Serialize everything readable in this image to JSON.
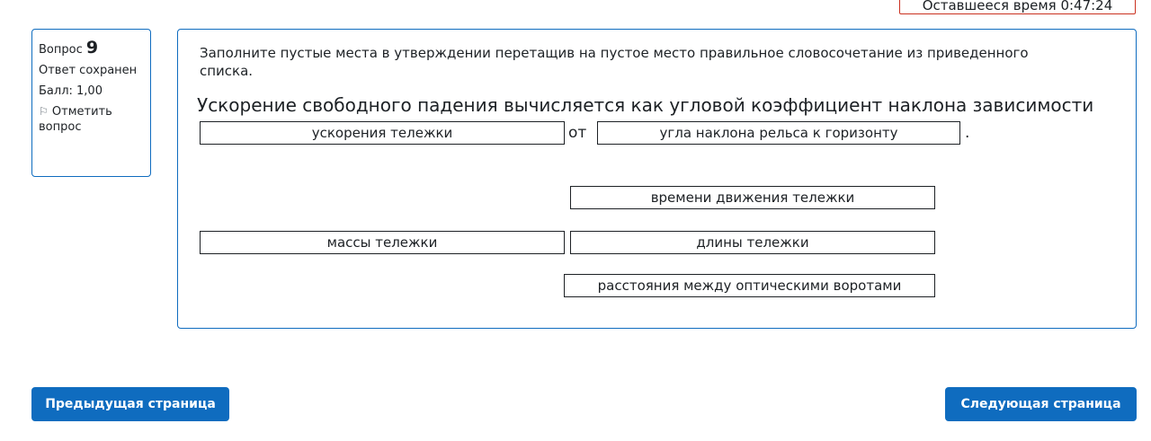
{
  "timer": {
    "label": "Оставшееся время 0:47:24"
  },
  "question_info": {
    "prefix": "Вопрос",
    "number": "9",
    "status": "Ответ сохранен",
    "score": "Балл: 1,00",
    "flag_label": "Отметить вопрос",
    "flag_icon": "flag-icon"
  },
  "question": {
    "prompt": "Заполните пустые места в утверждении перетащив на пустое место  правильное словосочетание из приведенного списка.",
    "statement": "Ускорение свободного падения вычисляется как угловой коэффициент наклона зависимости",
    "drop1": "ускорения тележки",
    "connector": "от",
    "drop2": "угла наклона рельса к горизонту",
    "end": "."
  },
  "choices": {
    "c1": "времени движения тележки",
    "c2": "массы тележки",
    "c3": "длины тележки",
    "c4": "расстояния между оптическими воротами"
  },
  "nav": {
    "prev": "Предыдущая страница",
    "next": "Следующая страница"
  },
  "colors": {
    "accent": "#0f6cbf",
    "timer_border": "#ca3120"
  }
}
